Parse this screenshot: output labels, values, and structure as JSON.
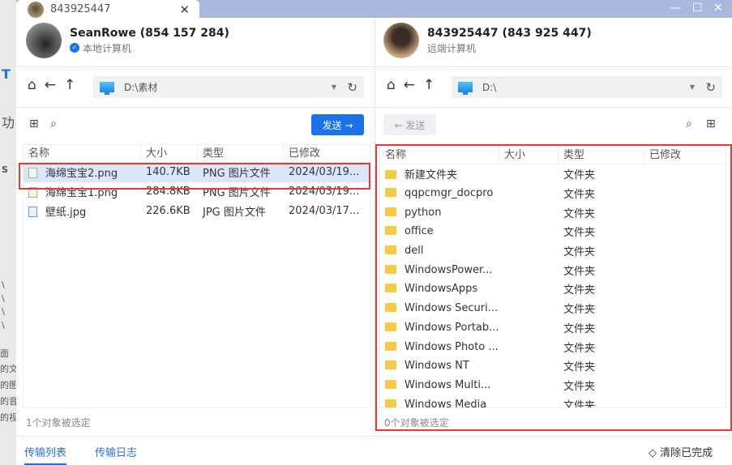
{
  "background_fragments": [
    "T",
    "功",
    "S",
    "\\",
    "\\",
    "\\",
    "\\",
    "面",
    "的文",
    "的图",
    "的音",
    "的视"
  ],
  "tab": {
    "title": "843925447"
  },
  "window_controls": {
    "minimize": "—",
    "maximize": "☐",
    "close": "✕"
  },
  "local": {
    "name": "SeanRowe (854 157 284)",
    "label": "本地计算机",
    "path": "D:\\素材",
    "send_label": "发送 →",
    "columns": [
      "名称",
      "大小",
      "类型",
      "已修改"
    ],
    "files": [
      {
        "name": "海绵宝宝2.png",
        "size": "140.7KB",
        "type": "PNG 图片文件",
        "modified": "2024/03/19...",
        "selected": true,
        "icon": "png-file-icon"
      },
      {
        "name": "海绵宝宝1.png",
        "size": "284.8KB",
        "type": "PNG 图片文件",
        "modified": "2024/03/19...",
        "icon": "png-file-icon"
      },
      {
        "name": "壁纸.jpg",
        "size": "226.6KB",
        "type": "JPG 图片文件",
        "modified": "2024/03/17...",
        "icon": "jpg-file-icon"
      }
    ],
    "status": "1个对象被选定"
  },
  "remote": {
    "name": "843925447 (843 925 447)",
    "label": "远端计算机",
    "path": "D:\\",
    "send_label": "← 发送",
    "columns": [
      "名称",
      "大小",
      "类型",
      "已修改"
    ],
    "files": [
      {
        "name": "新建文件夹",
        "type": "文件夹"
      },
      {
        "name": "qqpcmgr_docpro",
        "type": "文件夹"
      },
      {
        "name": "python",
        "type": "文件夹"
      },
      {
        "name": "office",
        "type": "文件夹"
      },
      {
        "name": "dell",
        "type": "文件夹"
      },
      {
        "name": "WindowsPower...",
        "type": "文件夹"
      },
      {
        "name": "WindowsApps",
        "type": "文件夹"
      },
      {
        "name": "Windows Securi...",
        "type": "文件夹"
      },
      {
        "name": "Windows Portab...",
        "type": "文件夹"
      },
      {
        "name": "Windows Photo ...",
        "type": "文件夹"
      },
      {
        "name": "Windows NT",
        "type": "文件夹"
      },
      {
        "name": "Windows Multi...",
        "type": "文件夹"
      },
      {
        "name": "Windows Media",
        "type": "文件夹"
      }
    ],
    "status": "0个对象被选定"
  },
  "bottom": {
    "tabs": [
      "传输列表",
      "传输日志"
    ],
    "clear_label": "清除已完成"
  },
  "colors": {
    "accent": "#1a73e8",
    "highlight": "#e53935",
    "titlebar": "#a9b8dc",
    "selected_row": "#dce6fa"
  }
}
